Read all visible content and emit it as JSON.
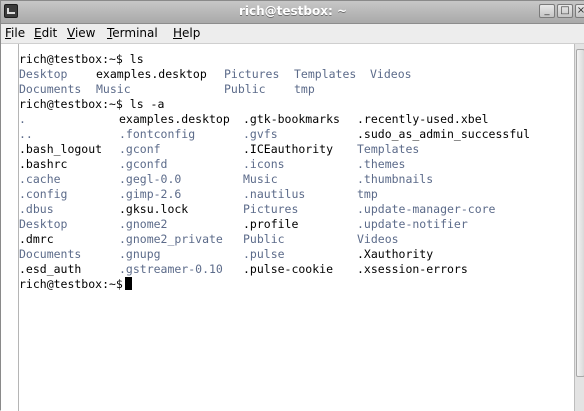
{
  "window": {
    "title": "rich@testbox: ~"
  },
  "menu": [
    {
      "pre": "",
      "acc": "F",
      "post": "ile"
    },
    {
      "pre": "",
      "acc": "E",
      "post": "dit"
    },
    {
      "pre": "",
      "acc": "V",
      "post": "iew"
    },
    {
      "pre": "",
      "acc": "T",
      "post": "erminal"
    },
    {
      "pre": "",
      "acc": "H",
      "post": "elp"
    }
  ],
  "terminal": {
    "prompt1": "rich@testbox:~$ ls",
    "ls": [
      [
        "Desktop",
        "examples.desktop",
        "Pictures",
        "Templates",
        "Videos"
      ],
      [
        "Documents",
        "Music",
        "Public",
        "tmp",
        ""
      ]
    ],
    "prompt2": "rich@testbox:~$ ls -a",
    "lsa": [
      [
        ".",
        "examples.desktop",
        ".gtk-bookmarks",
        ".recently-used.xbel"
      ],
      [
        "..",
        ".fontconfig",
        ".gvfs",
        ".sudo_as_admin_successful"
      ],
      [
        ".bash_logout",
        ".gconf",
        ".ICEauthority",
        "Templates"
      ],
      [
        ".bashrc",
        ".gconfd",
        ".icons",
        ".themes"
      ],
      [
        ".cache",
        ".gegl-0.0",
        "Music",
        ".thumbnails"
      ],
      [
        ".config",
        ".gimp-2.6",
        ".nautilus",
        "tmp"
      ],
      [
        ".dbus",
        ".gksu.lock",
        "Pictures",
        ".update-manager-core"
      ],
      [
        "Desktop",
        ".gnome2",
        ".profile",
        ".update-notifier"
      ],
      [
        ".dmrc",
        ".gnome2_private",
        "Public",
        "Videos"
      ],
      [
        "Documents",
        ".gnupg",
        ".pulse",
        ".Xauthority"
      ],
      [
        ".esd_auth",
        ".gstreamer-0.10",
        ".pulse-cookie",
        ".xsession-errors"
      ]
    ],
    "prompt3": "rich@testbox:~$",
    "colors": {
      "directory": "#5c6b8a",
      "file": "#000000"
    }
  }
}
